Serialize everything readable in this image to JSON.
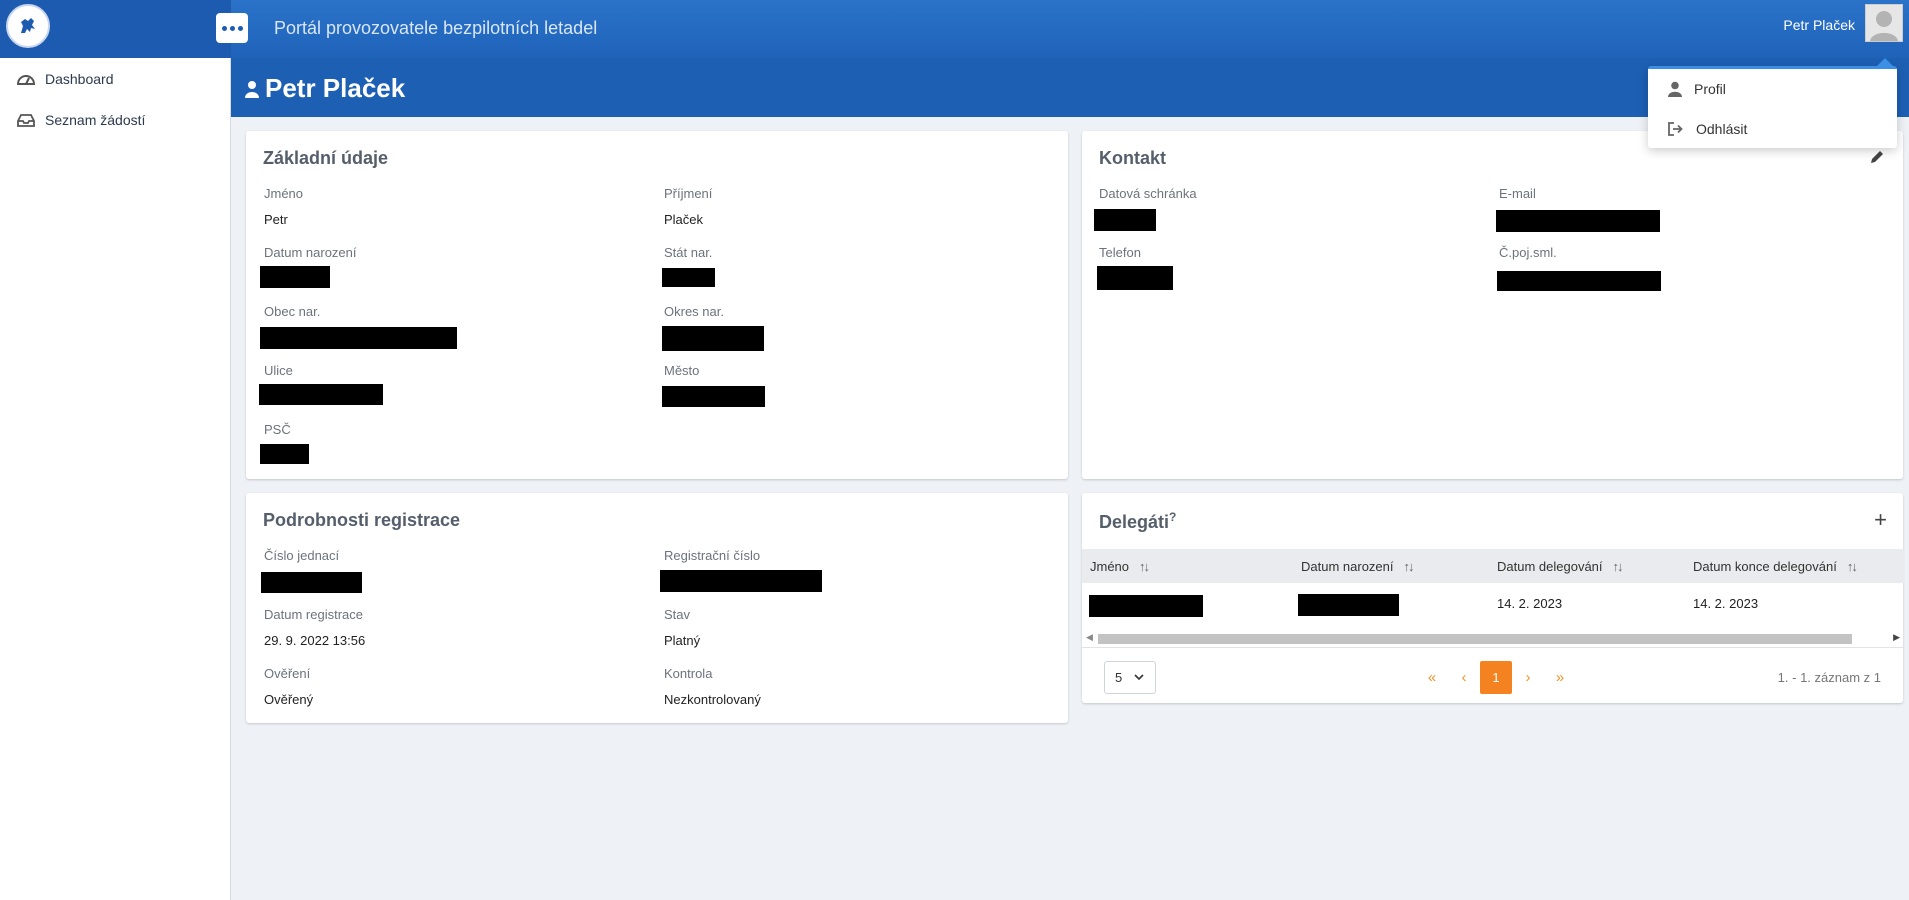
{
  "header": {
    "app_title": "Portál provozovatele bezpilotních letadel",
    "user_name": "Petr Plaček"
  },
  "user_menu": {
    "items": [
      {
        "label": "Profil",
        "icon": "user-icon"
      },
      {
        "label": "Odhlásit",
        "icon": "logout-icon"
      }
    ]
  },
  "sidebar": {
    "items": [
      {
        "label": "Dashboard",
        "icon": "speedometer-icon"
      },
      {
        "label": "Seznam žádostí",
        "icon": "inbox-icon"
      }
    ]
  },
  "page": {
    "title": "Petr Plaček"
  },
  "basic_info": {
    "title": "Základní údaje",
    "jmeno_label": "Jméno",
    "jmeno_value": "Petr",
    "prijmeni_label": "Příjmení",
    "prijmeni_value": "Plaček",
    "datum_narozeni_label": "Datum narození",
    "stat_label": "Stát nar.",
    "obec_label": "Obec nar.",
    "okres_label": "Okres nar.",
    "ulice_label": "Ulice",
    "mesto_label": "Město",
    "psc_label": "PSČ"
  },
  "contact": {
    "title": "Kontakt",
    "datova_schranka_label": "Datová schránka",
    "email_label": "E-mail",
    "telefon_label": "Telefon",
    "poj_label": "Č.poj.sml."
  },
  "registration": {
    "title": "Podrobnosti registrace",
    "cislo_jednaci_label": "Číslo jednací",
    "registracni_cislo_label": "Registrační číslo",
    "datum_registrace_label": "Datum registrace",
    "datum_registrace_value": "29. 9. 2022 13:56",
    "stav_label": "Stav",
    "stav_value": "Platný",
    "overeni_label": "Ověření",
    "overeni_value": "Ověřený",
    "kontrola_label": "Kontrola",
    "kontrola_value": "Nezkontrolovaný"
  },
  "delegates": {
    "title": "Delegáti",
    "title_sup": "?",
    "columns": [
      "Jméno",
      "Datum narození",
      "Datum delegování",
      "Datum konce delegování"
    ],
    "rows": [
      {
        "datum_delegovani": "14. 2. 2023",
        "datum_konce": "14. 2. 2023"
      }
    ],
    "page_size": "5",
    "current_page": "1",
    "pager_info": "1. - 1. záznam z 1"
  }
}
